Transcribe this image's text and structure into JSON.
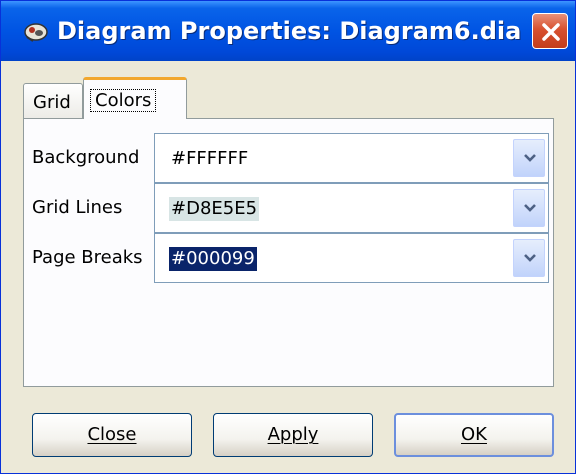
{
  "window": {
    "title": "Diagram Properties: Diagram6.dia"
  },
  "tabs": [
    {
      "label": "Grid",
      "active": false
    },
    {
      "label": "Colors",
      "active": true
    }
  ],
  "rows": [
    {
      "label": "Background",
      "value": "#FFFFFF"
    },
    {
      "label": "Grid Lines",
      "value": "#D8E5E5"
    },
    {
      "label": "Page Breaks",
      "value": "#000099"
    }
  ],
  "buttons": {
    "close": "Close",
    "apply": "Apply",
    "ok": "OK"
  },
  "icons": {
    "app": "dia-app-icon",
    "close": "close-icon",
    "dropdown": "chevron-down-icon"
  },
  "colors": {
    "title_bar": "#0054e3",
    "close_button": "#d8512f",
    "selection": "#0a246a",
    "tab_highlight": "#f2a72d"
  }
}
